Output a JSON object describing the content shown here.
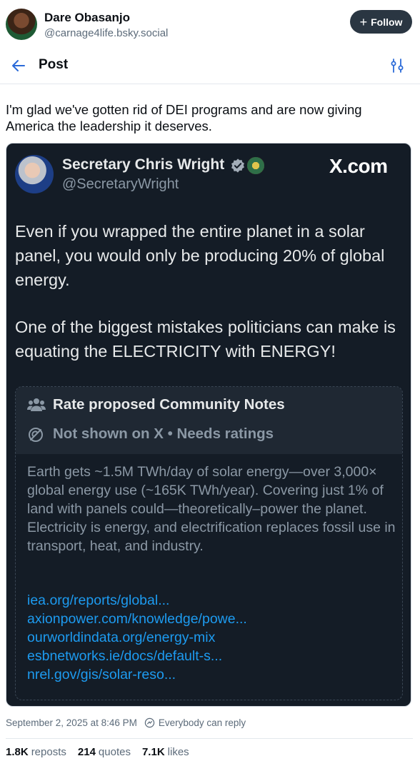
{
  "author": {
    "name": "Dare Obasanjo",
    "handle": "@carnage4life.bsky.social",
    "follow_label": "Follow"
  },
  "nav": {
    "title": "Post"
  },
  "post": {
    "text": "I'm glad we've gotten rid of DEI programs and are now giving America the leadership it deserves."
  },
  "embed": {
    "name": "Secretary Chris Wright",
    "handle": "@SecretaryWright",
    "brand": "X.com",
    "body1": "Even if you wrapped the entire planet in a solar panel, you would only be producing 20% of global energy.",
    "body2": "One of the biggest mistakes politicians can make is equating the ELECTRICITY with ENERGY!",
    "note": {
      "title": "Rate proposed Community Notes",
      "status": "Not shown on X • Needs ratings",
      "text": "Earth gets ~1.5M TWh/day of solar energy—over 3,000× global energy use (~165K TWh/year). Covering just 1% of land with panels could—theoretically–power the planet. Electricity is energy, and electrification replaces fossil use in transport, heat, and industry.",
      "links": [
        "iea.org/reports/global...",
        "axionpower.com/knowledge/powe...",
        "ourworldindata.org/energy-mix",
        "esbnetworks.ie/docs/default-s...",
        "nrel.gov/gis/solar-reso..."
      ]
    }
  },
  "meta": {
    "timestamp": "September 2, 2025 at 8:46 PM",
    "reply_setting": "Everybody can reply"
  },
  "stats": {
    "reposts_count": "1.8K",
    "reposts_label": "reposts",
    "quotes_count": "214",
    "quotes_label": "quotes",
    "likes_count": "7.1K",
    "likes_label": "likes"
  },
  "colors": {
    "accent": "#1d9bf0",
    "embed_bg": "#141c26",
    "follow_bg": "#2a3642"
  },
  "icons": [
    "back-arrow-icon",
    "thread-settings-icon",
    "plus-icon",
    "verified-badge-icon",
    "people-icon",
    "eye-off-icon",
    "reply-settings-icon"
  ]
}
